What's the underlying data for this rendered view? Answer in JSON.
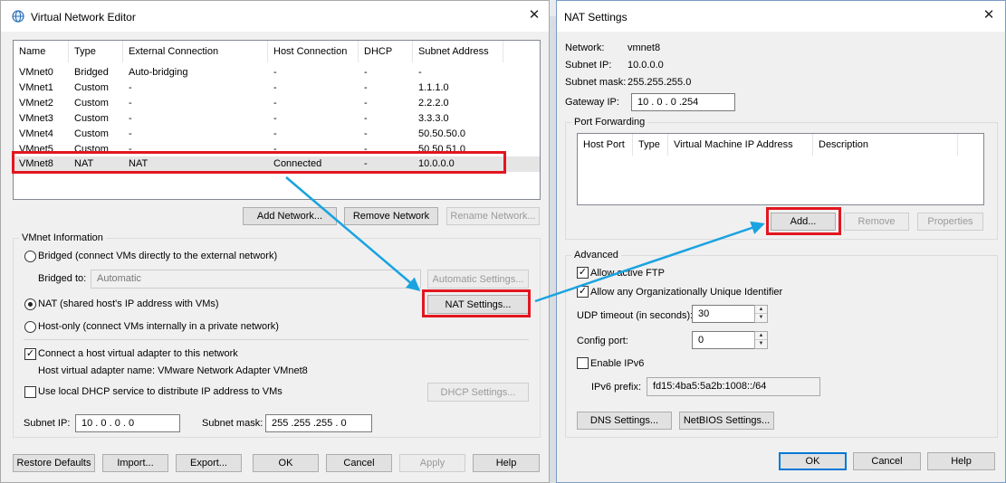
{
  "left_window": {
    "title": "Virtual Network Editor",
    "table": {
      "columns": [
        "Name",
        "Type",
        "External Connection",
        "Host Connection",
        "DHCP",
        "Subnet Address"
      ],
      "rows": [
        [
          "VMnet0",
          "Bridged",
          "Auto-bridging",
          "-",
          "-",
          "-"
        ],
        [
          "VMnet1",
          "Custom",
          "-",
          "-",
          "-",
          "1.1.1.0"
        ],
        [
          "VMnet2",
          "Custom",
          "-",
          "-",
          "-",
          "2.2.2.0"
        ],
        [
          "VMnet3",
          "Custom",
          "-",
          "-",
          "-",
          "3.3.3.0"
        ],
        [
          "VMnet4",
          "Custom",
          "-",
          "-",
          "-",
          "50.50.50.0"
        ],
        [
          "VMnet5",
          "Custom",
          "-",
          "-",
          "-",
          "50.50.51.0"
        ],
        [
          "VMnet8",
          "NAT",
          "NAT",
          "Connected",
          "-",
          "10.0.0.0"
        ]
      ]
    },
    "add_network": "Add Network...",
    "remove_network": "Remove Network",
    "rename_network": "Rename Network...",
    "vmnet_info": {
      "label": "VMnet Information",
      "bridged": "Bridged (connect VMs directly to the external network)",
      "bridged_to_label": "Bridged to:",
      "bridged_to_value": "Automatic",
      "automatic_settings": "Automatic Settings...",
      "nat": "NAT (shared host's IP address with VMs)",
      "nat_settings": "NAT Settings...",
      "host_only": "Host-only (connect VMs internally in a private network)",
      "connect_adapter": "Connect a host virtual adapter to this network",
      "adapter_name": "Host virtual adapter name: VMware Network Adapter VMnet8",
      "use_dhcp": "Use local DHCP service to distribute IP address to VMs",
      "dhcp_settings": "DHCP Settings...",
      "subnet_ip_label": "Subnet IP:",
      "subnet_ip": "10 . 0 . 0 . 0",
      "subnet_mask_label": "Subnet mask:",
      "subnet_mask": "255 .255 .255 . 0"
    },
    "buttons": {
      "restore": "Restore Defaults",
      "import": "Import...",
      "export": "Export...",
      "ok": "OK",
      "cancel": "Cancel",
      "apply": "Apply",
      "help": "Help"
    }
  },
  "right_window": {
    "title": "NAT Settings",
    "network_label": "Network:",
    "network_value": "vmnet8",
    "subnet_ip_label": "Subnet IP:",
    "subnet_ip_value": "10.0.0.0",
    "subnet_mask_label": "Subnet mask:",
    "subnet_mask_value": "255.255.255.0",
    "gateway_label": "Gateway IP:",
    "gateway_value": "10 . 0 . 0 .254",
    "port_forwarding": {
      "label": "Port Forwarding",
      "columns": [
        "Host Port",
        "Type",
        "Virtual Machine IP Address",
        "Description"
      ],
      "add": "Add...",
      "remove": "Remove",
      "properties": "Properties"
    },
    "advanced": {
      "label": "Advanced",
      "allow_ftp": "Allow active FTP",
      "allow_oui": "Allow any Organizationally Unique Identifier",
      "udp_timeout_label": "UDP timeout (in seconds):",
      "udp_timeout": "30",
      "config_port_label": "Config port:",
      "config_port": "0",
      "enable_ipv6": "Enable IPv6",
      "ipv6_prefix_label": "IPv6 prefix:",
      "ipv6_prefix": "fd15:4ba5:5a2b:1008::/64",
      "dns_settings": "DNS Settings...",
      "netbios_settings": "NetBIOS Settings..."
    },
    "buttons": {
      "ok": "OK",
      "cancel": "Cancel",
      "help": "Help"
    }
  },
  "colors": {
    "highlight_box": "#e3161f",
    "arrow": "#1aa3e0",
    "default_button_border": "#0078d7"
  }
}
